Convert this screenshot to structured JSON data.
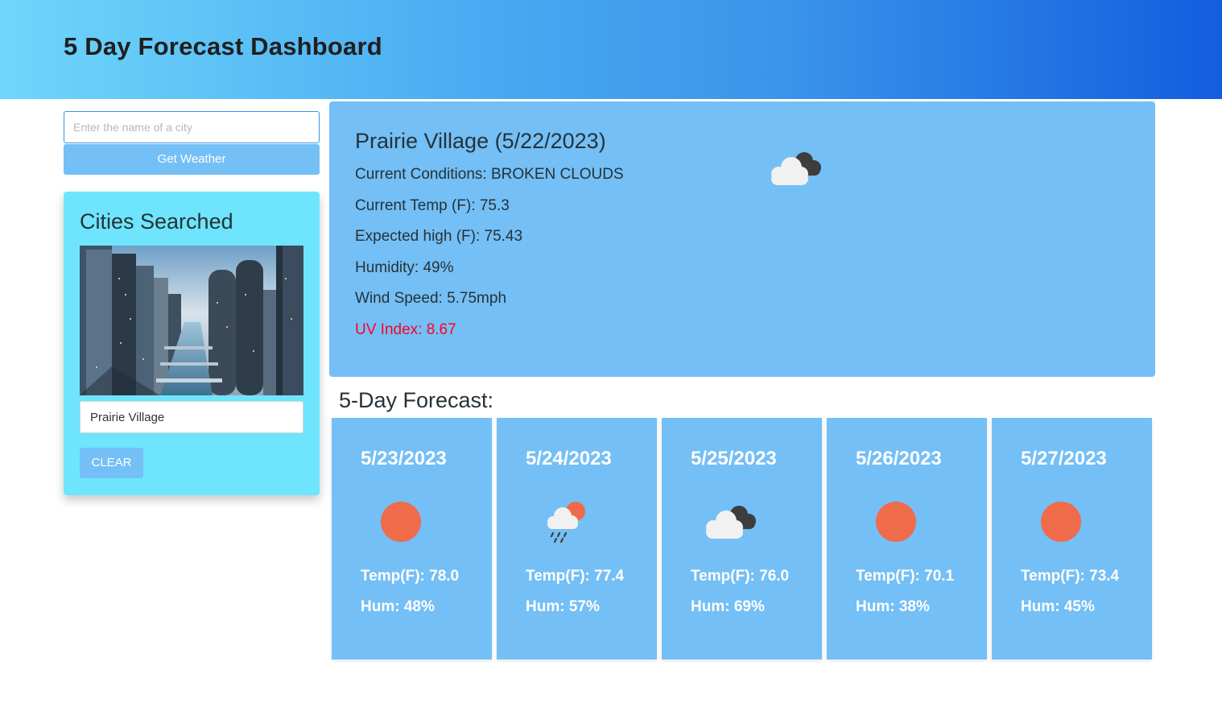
{
  "header": {
    "title": "5 Day Forecast Dashboard"
  },
  "search": {
    "placeholder": "Enter the name of a city",
    "value": "",
    "button_label": "Get Weather"
  },
  "sidebar": {
    "title": "Cities Searched",
    "cities": [
      "Prairie Village"
    ],
    "clear_label": "CLEAR"
  },
  "current": {
    "title": "Prairie Village (5/22/2023)",
    "conditions": "Current Conditions: BROKEN CLOUDS",
    "temp": "Current Temp (F): 75.3",
    "high": "Expected high (F): 75.43",
    "humidity": "Humidity: 49%",
    "wind": "Wind Speed: 5.75mph",
    "uv": "UV Index: 8.67",
    "uv_color": "#ff0022",
    "icon": "broken-clouds-icon"
  },
  "forecast": {
    "title": "5-Day Forecast:",
    "days": [
      {
        "date": "5/23/2023",
        "icon": "clear-sun-icon",
        "temp": "Temp(F): 78.0",
        "hum": "Hum: 48%"
      },
      {
        "date": "5/24/2023",
        "icon": "rain-icon",
        "temp": "Temp(F): 77.4",
        "hum": "Hum: 57%"
      },
      {
        "date": "5/25/2023",
        "icon": "broken-clouds-icon",
        "temp": "Temp(F): 76.0",
        "hum": "Hum: 69%"
      },
      {
        "date": "5/26/2023",
        "icon": "clear-sun-icon",
        "temp": "Temp(F): 70.1",
        "hum": "Hum: 38%"
      },
      {
        "date": "5/27/2023",
        "icon": "clear-sun-icon",
        "temp": "Temp(F): 73.4",
        "hum": "Hum: 45%"
      }
    ]
  },
  "colors": {
    "card": "#74bff5",
    "sidebar_card": "#6ee5fd",
    "sun": "#ef6b4a",
    "header_gradient_start": "#6fd6fb",
    "header_gradient_end": "#135ddf"
  }
}
